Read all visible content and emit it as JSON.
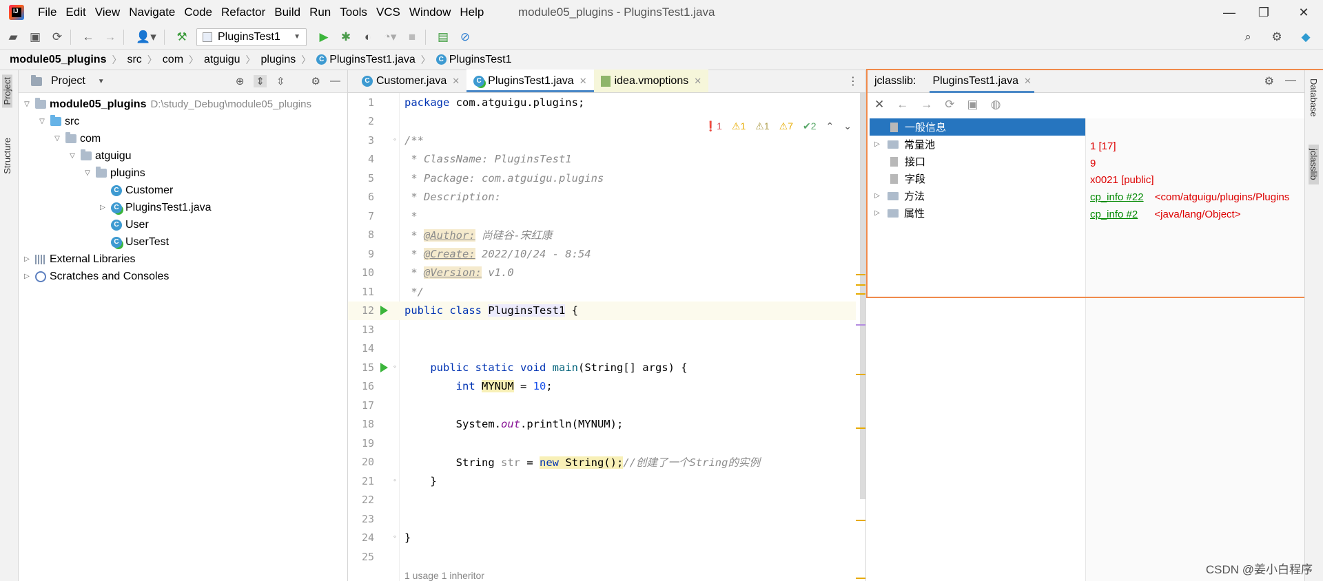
{
  "window": {
    "title": "module05_plugins - PluginsTest1.java",
    "menu": [
      "File",
      "Edit",
      "View",
      "Navigate",
      "Code",
      "Refactor",
      "Build",
      "Run",
      "Tools",
      "VCS",
      "Window",
      "Help"
    ]
  },
  "toolbar": {
    "run_config": "PluginsTest1"
  },
  "breadcrumb": [
    "module05_plugins",
    "src",
    "com",
    "atguigu",
    "plugins",
    "PluginsTest1.java",
    "PluginsTest1"
  ],
  "left_strip": {
    "project": "Project",
    "structure": "Structure"
  },
  "project": {
    "title": "Project",
    "root_name": "module05_plugins",
    "root_path": "D:\\study_Debug\\module05_plugins",
    "src": "src",
    "com": "com",
    "atguigu": "atguigu",
    "plugins": "plugins",
    "files": [
      "Customer",
      "PluginsTest1.java",
      "User",
      "UserTest"
    ],
    "external": "External Libraries",
    "scratches": "Scratches and Consoles"
  },
  "editor": {
    "tabs": [
      "Customer.java",
      "PluginsTest1.java",
      "idea.vmoptions"
    ],
    "inspections": {
      "errors": "1",
      "warnings": "1",
      "weak": "1",
      "typos": "7",
      "ok": "2"
    },
    "line_numbers": [
      "1",
      "2",
      "3",
      "4",
      "5",
      "6",
      "7",
      "8",
      "9",
      "10",
      "11",
      "12",
      "13",
      "14",
      "15",
      "16",
      "17",
      "18",
      "19",
      "20",
      "21",
      "22",
      "23",
      "24",
      "25"
    ],
    "usage_hint": "1 usage    1 inheritor"
  },
  "code": {
    "l1_kw": "package",
    "l1_rest": " com.atguigu.plugins;",
    "l3": "/**",
    "l4": " * ClassName: PluginsTest1",
    "l5": " * Package: com.atguigu.plugins",
    "l6": " * Description:",
    "l7": " *",
    "l8_pre": " * ",
    "l8_tag": "@Author:",
    "l8_val": " 尚硅谷-宋红康",
    "l9_pre": " * ",
    "l9_tag": "@Create:",
    "l9_val": " 2022/10/24 - 8:54",
    "l10_pre": " * ",
    "l10_tag": "@Version:",
    "l10_val": " v1.0",
    "l11": " */",
    "l12_kw": "public class",
    "l12_cls": "PluginsTest1",
    "l12_rest": " {",
    "l15_kw": "public static void",
    "l15_fn": "main",
    "l15_rest": "(String[] args) {",
    "l16_kw": "int",
    "l16_var": "MYNUM",
    "l16_eq": " = ",
    "l16_num": "10",
    "l16_end": ";",
    "l18_a": "System.",
    "l18_out": "out",
    "l18_b": ".println(MYNUM);",
    "l20_a": "String ",
    "l20_var": "str",
    "l20_b": " = ",
    "l20_new": "new",
    "l20_c": " String();",
    "l20_cmt": "//创建了一个String的实例",
    "l21": "}",
    "l24": "}"
  },
  "jclasslib": {
    "label": "jclasslib:",
    "tab": "PluginsTest1.java",
    "tree": [
      {
        "label": "一般信息",
        "selected": true,
        "expandable": false,
        "kind": "doc"
      },
      {
        "label": "常量池",
        "selected": false,
        "expandable": true,
        "kind": "dir"
      },
      {
        "label": "接口",
        "selected": false,
        "expandable": false,
        "kind": "doc"
      },
      {
        "label": "字段",
        "selected": false,
        "expandable": false,
        "kind": "doc"
      },
      {
        "label": "方法",
        "selected": false,
        "expandable": true,
        "kind": "dir"
      },
      {
        "label": "属性",
        "selected": false,
        "expandable": true,
        "kind": "dir"
      }
    ],
    "details": {
      "d1": "1 [17]",
      "d2": "9",
      "d3": "x0021 [public]",
      "d4_link": "cp_info #22",
      "d4_val": "<com/atguigu/plugins/Plugins",
      "d5_link": "cp_info #2",
      "d5_val": "<java/lang/Object>"
    }
  },
  "right_strip": {
    "database": "Database",
    "jclasslib": "jclasslib"
  },
  "watermark": "CSDN @姜小白程序",
  "colors": {
    "accent": "#4a88c7",
    "selection": "#2675bf",
    "highlight_border": "#f08a4b",
    "run_green": "#3bb53b"
  }
}
